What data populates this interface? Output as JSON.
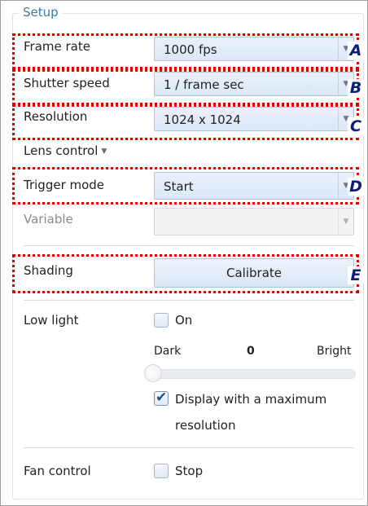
{
  "setup": {
    "title": "Setup",
    "frame_rate": {
      "label": "Frame rate",
      "value": "1000 fps",
      "marker": "A"
    },
    "shutter_speed": {
      "label": "Shutter speed",
      "value": "1 / frame sec",
      "marker": "B"
    },
    "resolution": {
      "label": "Resolution",
      "value": "1024 x 1024",
      "marker": "C"
    },
    "lens_control": {
      "label": "Lens control"
    },
    "trigger_mode": {
      "label": "Trigger mode",
      "value": "Start",
      "marker": "D"
    },
    "variable": {
      "label": "Variable",
      "value": ""
    },
    "shading": {
      "label": "Shading",
      "button_label": "Calibrate",
      "marker": "E"
    },
    "low_light": {
      "label": "Low light",
      "checkbox_label": "On",
      "checked": false,
      "slider_left_label": "Dark",
      "slider_value": "0",
      "slider_right_label": "Bright",
      "slider_level": 0
    },
    "display_max_resolution": {
      "label_line1": "Display with a maximum",
      "label_line2": "resolution",
      "checked": true
    },
    "fan_control": {
      "label": "Fan control",
      "checkbox_label": "Stop",
      "checked": false
    }
  },
  "colors": {
    "highlight": "#e00000",
    "marker_text": "#0d1e78",
    "group_title": "#3a7aa8"
  },
  "icons": {
    "dropdown": "chevron-down-icon",
    "check": "checkmark-icon"
  }
}
